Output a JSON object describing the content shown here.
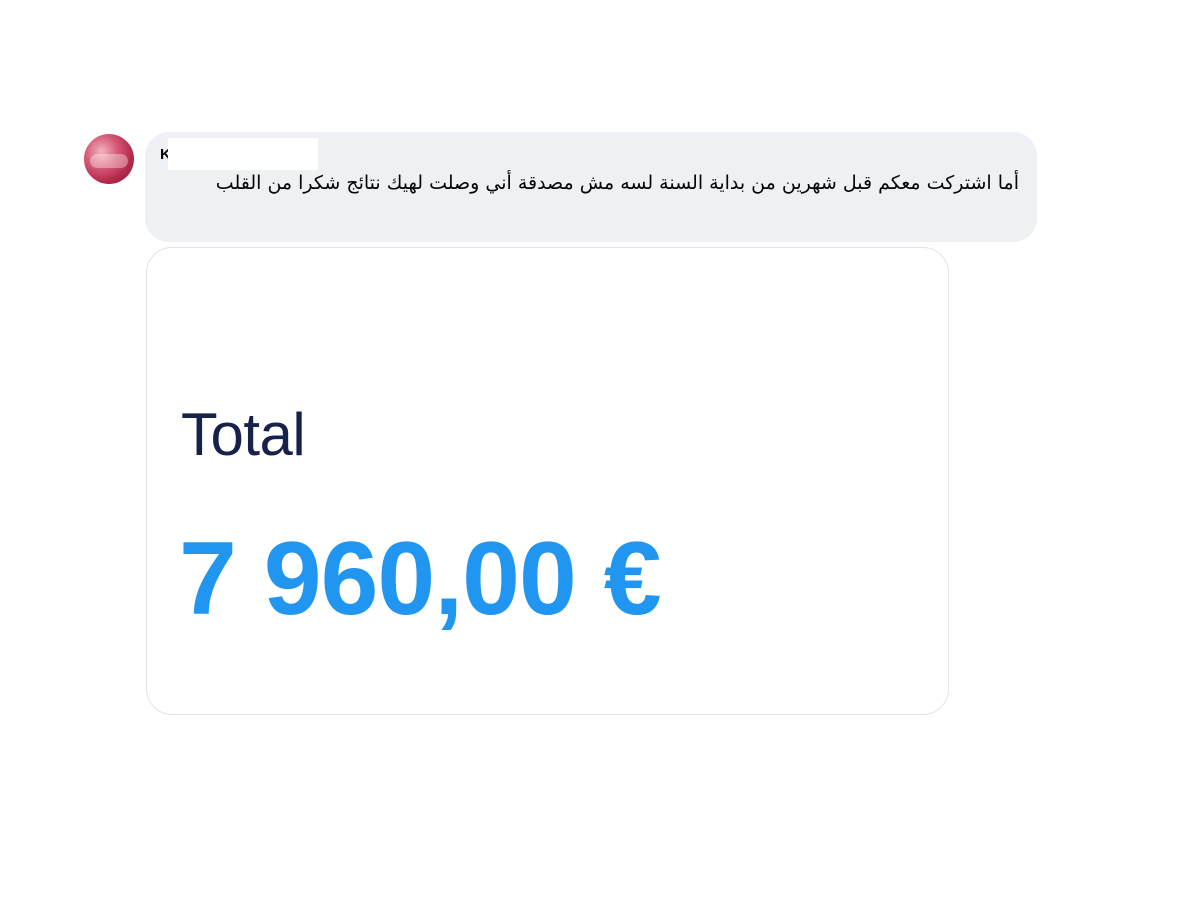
{
  "comment": {
    "author_initial": "K",
    "text": "أما اشتركت معكم قبل شهرين من بداية السنة لسه مش مصدقة أني وصلت لهيك نتائج شكرا من القلب",
    "avatar_icon": "profile-avatar"
  },
  "attachment": {
    "label": "Total",
    "amount": "7 960,00 €"
  },
  "colors": {
    "bubble_background": "#eff0f3",
    "label_color": "#17224a",
    "amount_color": "#2196f0"
  }
}
